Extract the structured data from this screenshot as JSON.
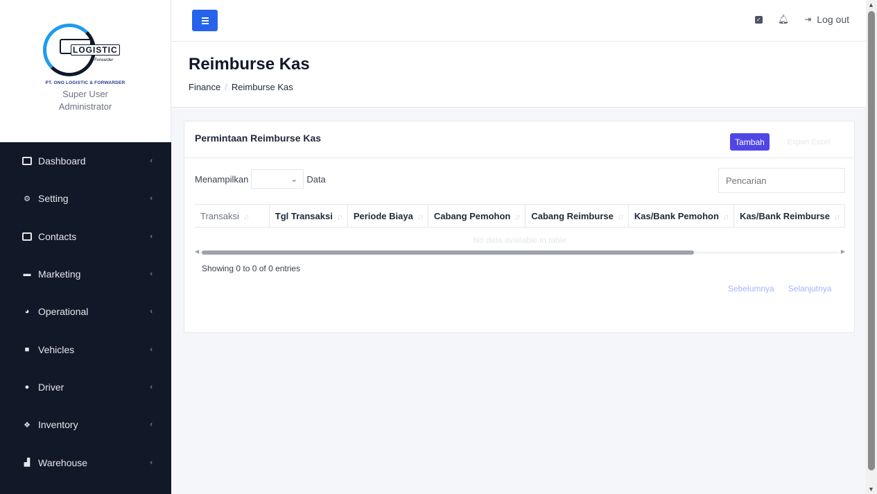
{
  "brand": {
    "logo_text": "LOGISTIC",
    "logo_sub": "Forwarder",
    "company": "PT. ONO LOGISTIC & FORWARDER",
    "user_name": "Super User",
    "user_role": "Administrator"
  },
  "sidebar": {
    "items": [
      {
        "label": "Dashboard",
        "icon": "id-card-icon"
      },
      {
        "label": "Setting",
        "icon": "gears-icon"
      },
      {
        "label": "Contacts",
        "icon": "id-card-icon"
      },
      {
        "label": "Marketing",
        "icon": "briefcase-icon"
      },
      {
        "label": "Operational",
        "icon": "gauge-icon"
      },
      {
        "label": "Vehicles",
        "icon": "truck-icon"
      },
      {
        "label": "Driver",
        "icon": "users-icon"
      },
      {
        "label": "Inventory",
        "icon": "cubes-icon"
      },
      {
        "label": "Warehouse",
        "icon": "industry-icon"
      }
    ]
  },
  "topbar": {
    "logout_label": "Log out"
  },
  "page": {
    "title": "Reimburse Kas",
    "breadcrumb": [
      "Finance",
      "Reimburse Kas"
    ]
  },
  "card": {
    "title": "Permintaan Reimburse Kas",
    "add_button": "Tambah",
    "export_button": "Export Excel",
    "length_prefix": "Menampilkan",
    "length_suffix": "Data",
    "length_value": "",
    "search_placeholder": "Pencarian",
    "columns": [
      "Transaksi",
      "Tgl Transaksi",
      "Periode Biaya",
      "Cabang Pemohon",
      "Cabang Reimburse",
      "Kas/Bank Pemohon",
      "Kas/Bank Reimburse"
    ],
    "empty_text": "No data available in table",
    "info": "Showing 0 to 0 of 0 entries",
    "prev_label": "Sebelumnya",
    "next_label": "Selanjutnya"
  },
  "colors": {
    "sidebar_bg": "#111827",
    "accent_blue": "#2563eb",
    "button_indigo": "#4f46e5"
  }
}
